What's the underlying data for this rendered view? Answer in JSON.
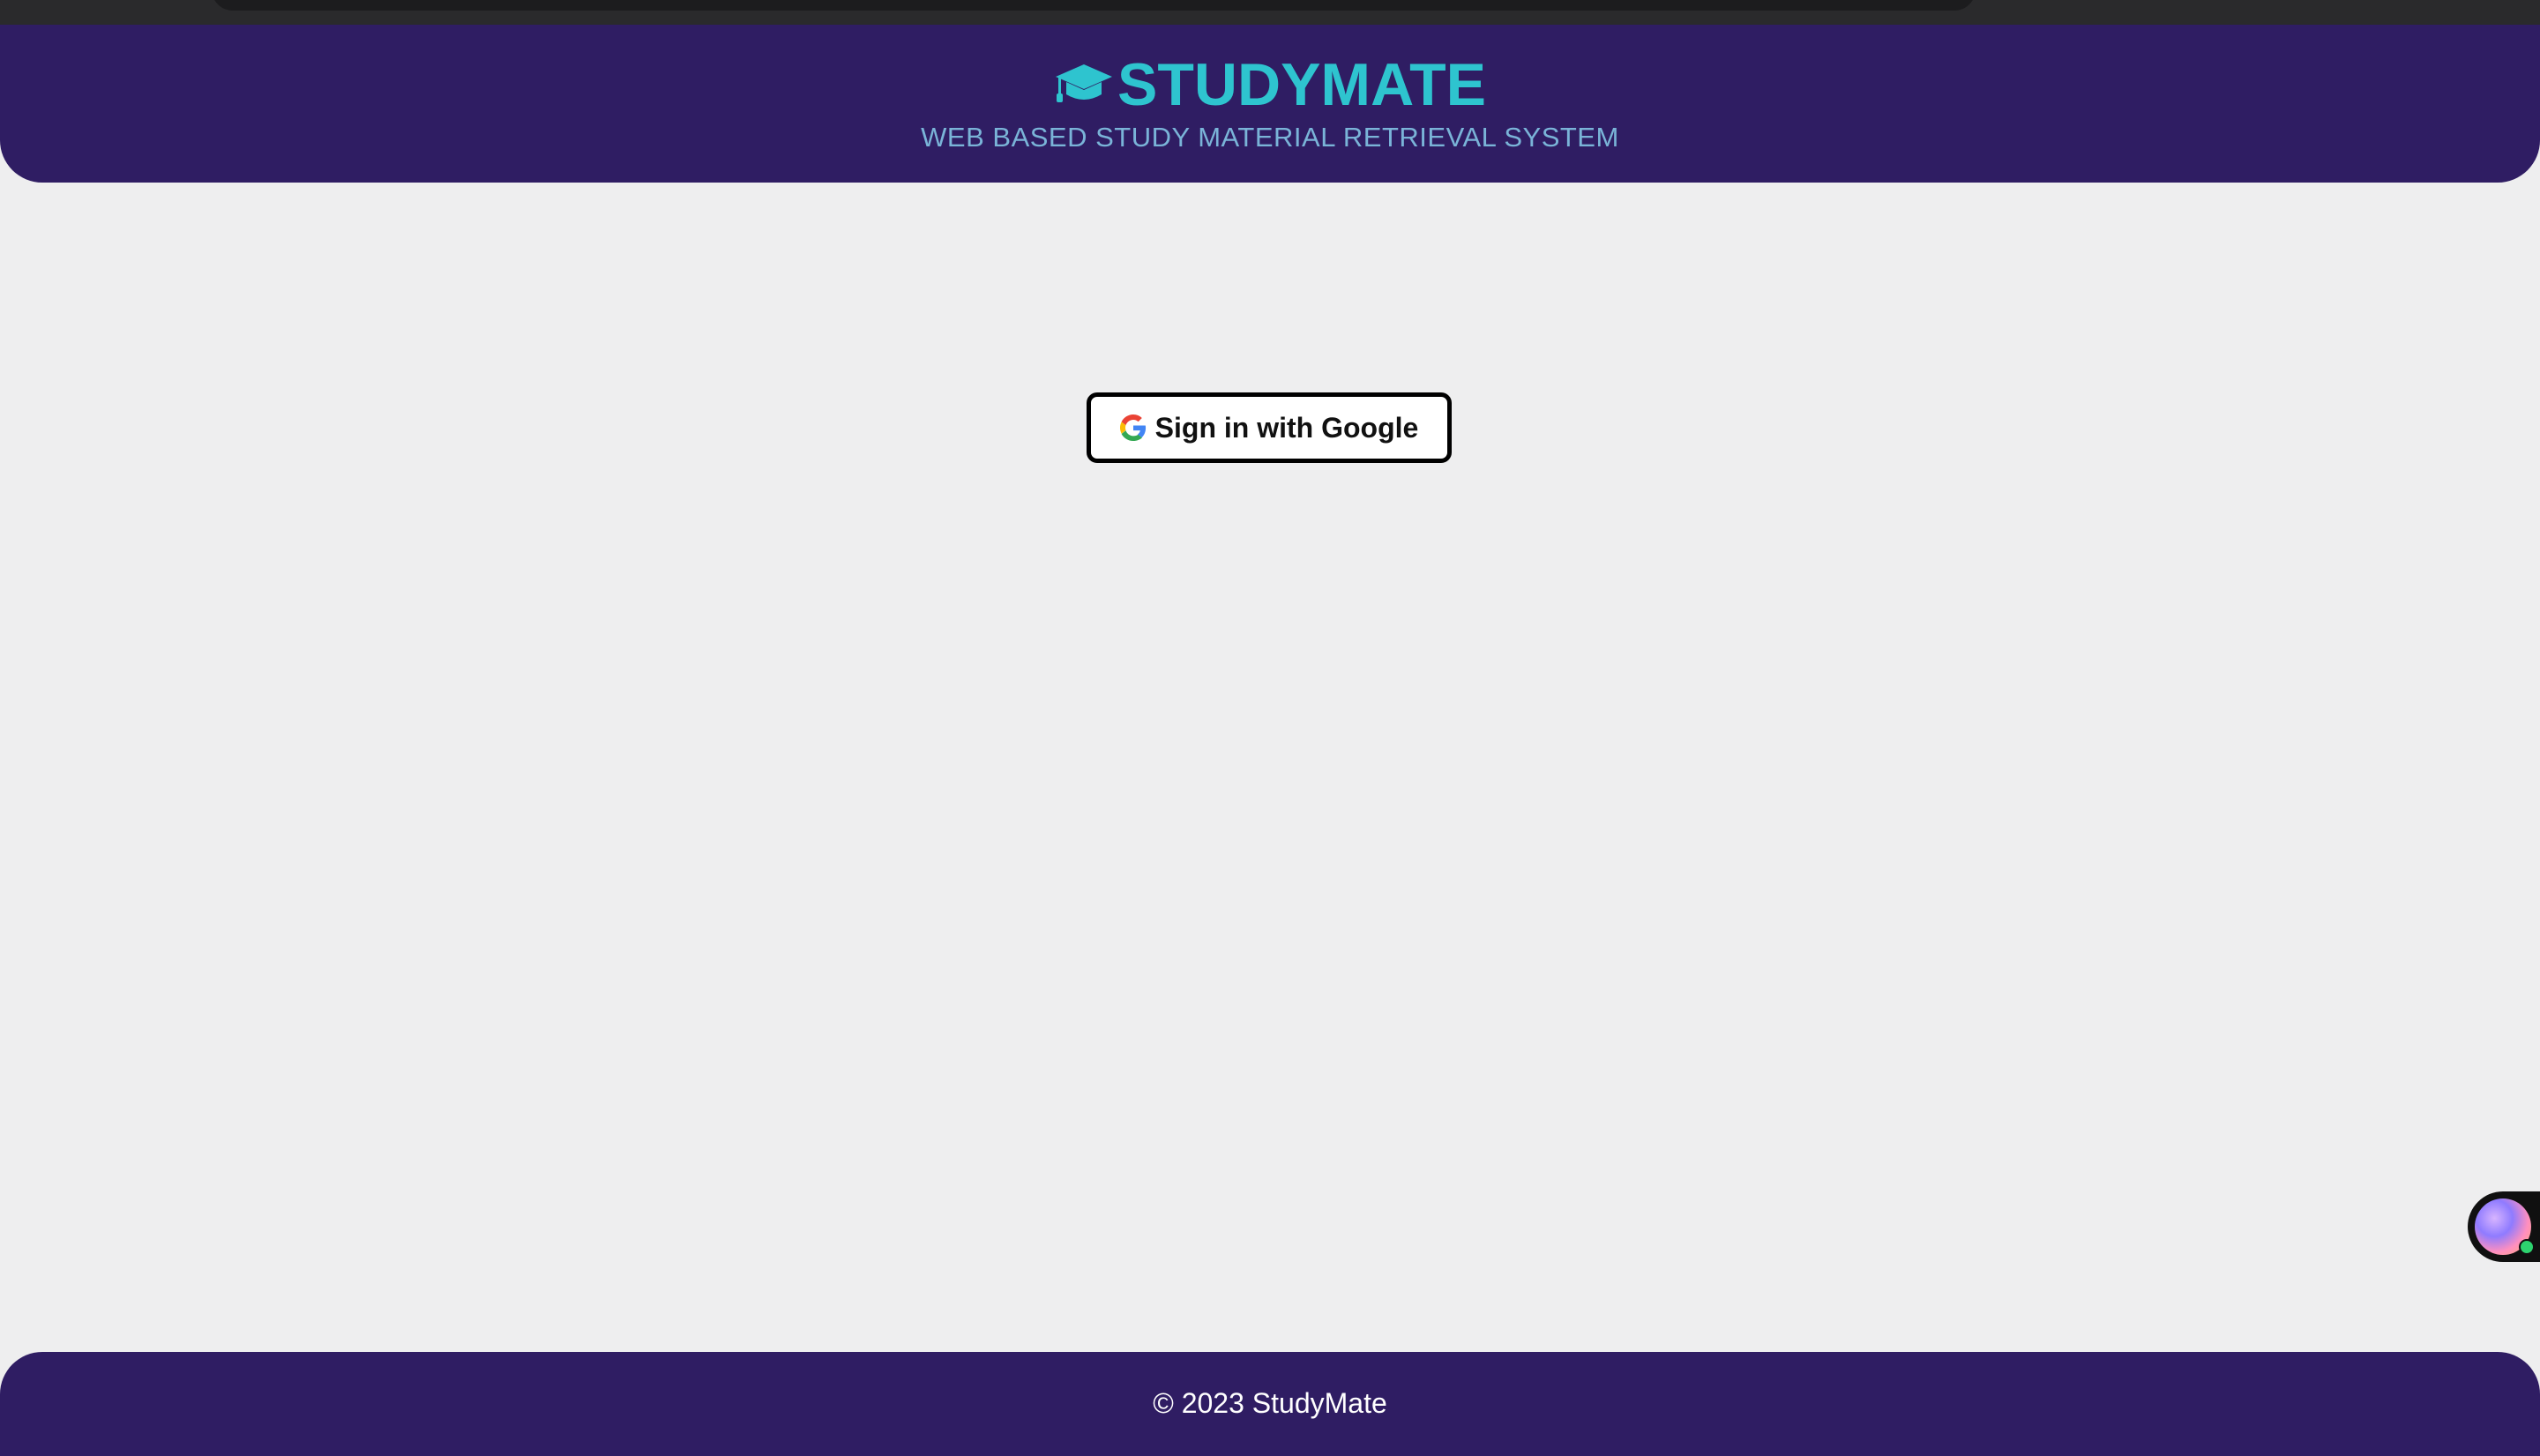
{
  "header": {
    "title": "STUDYMATE",
    "subtitle": "WEB BASED STUDY MATERIAL RETRIEVAL SYSTEM",
    "logo_icon": "graduation-cap-icon"
  },
  "auth": {
    "google_button_label": "Sign in with Google",
    "google_icon": "google-g-icon"
  },
  "footer": {
    "copyright": "© 2023 StudyMate"
  },
  "colors": {
    "header_bg": "#2f1d63",
    "brand": "#2ec4cf",
    "subtitle": "#7ab4d8",
    "page_bg": "#eeeeef"
  }
}
